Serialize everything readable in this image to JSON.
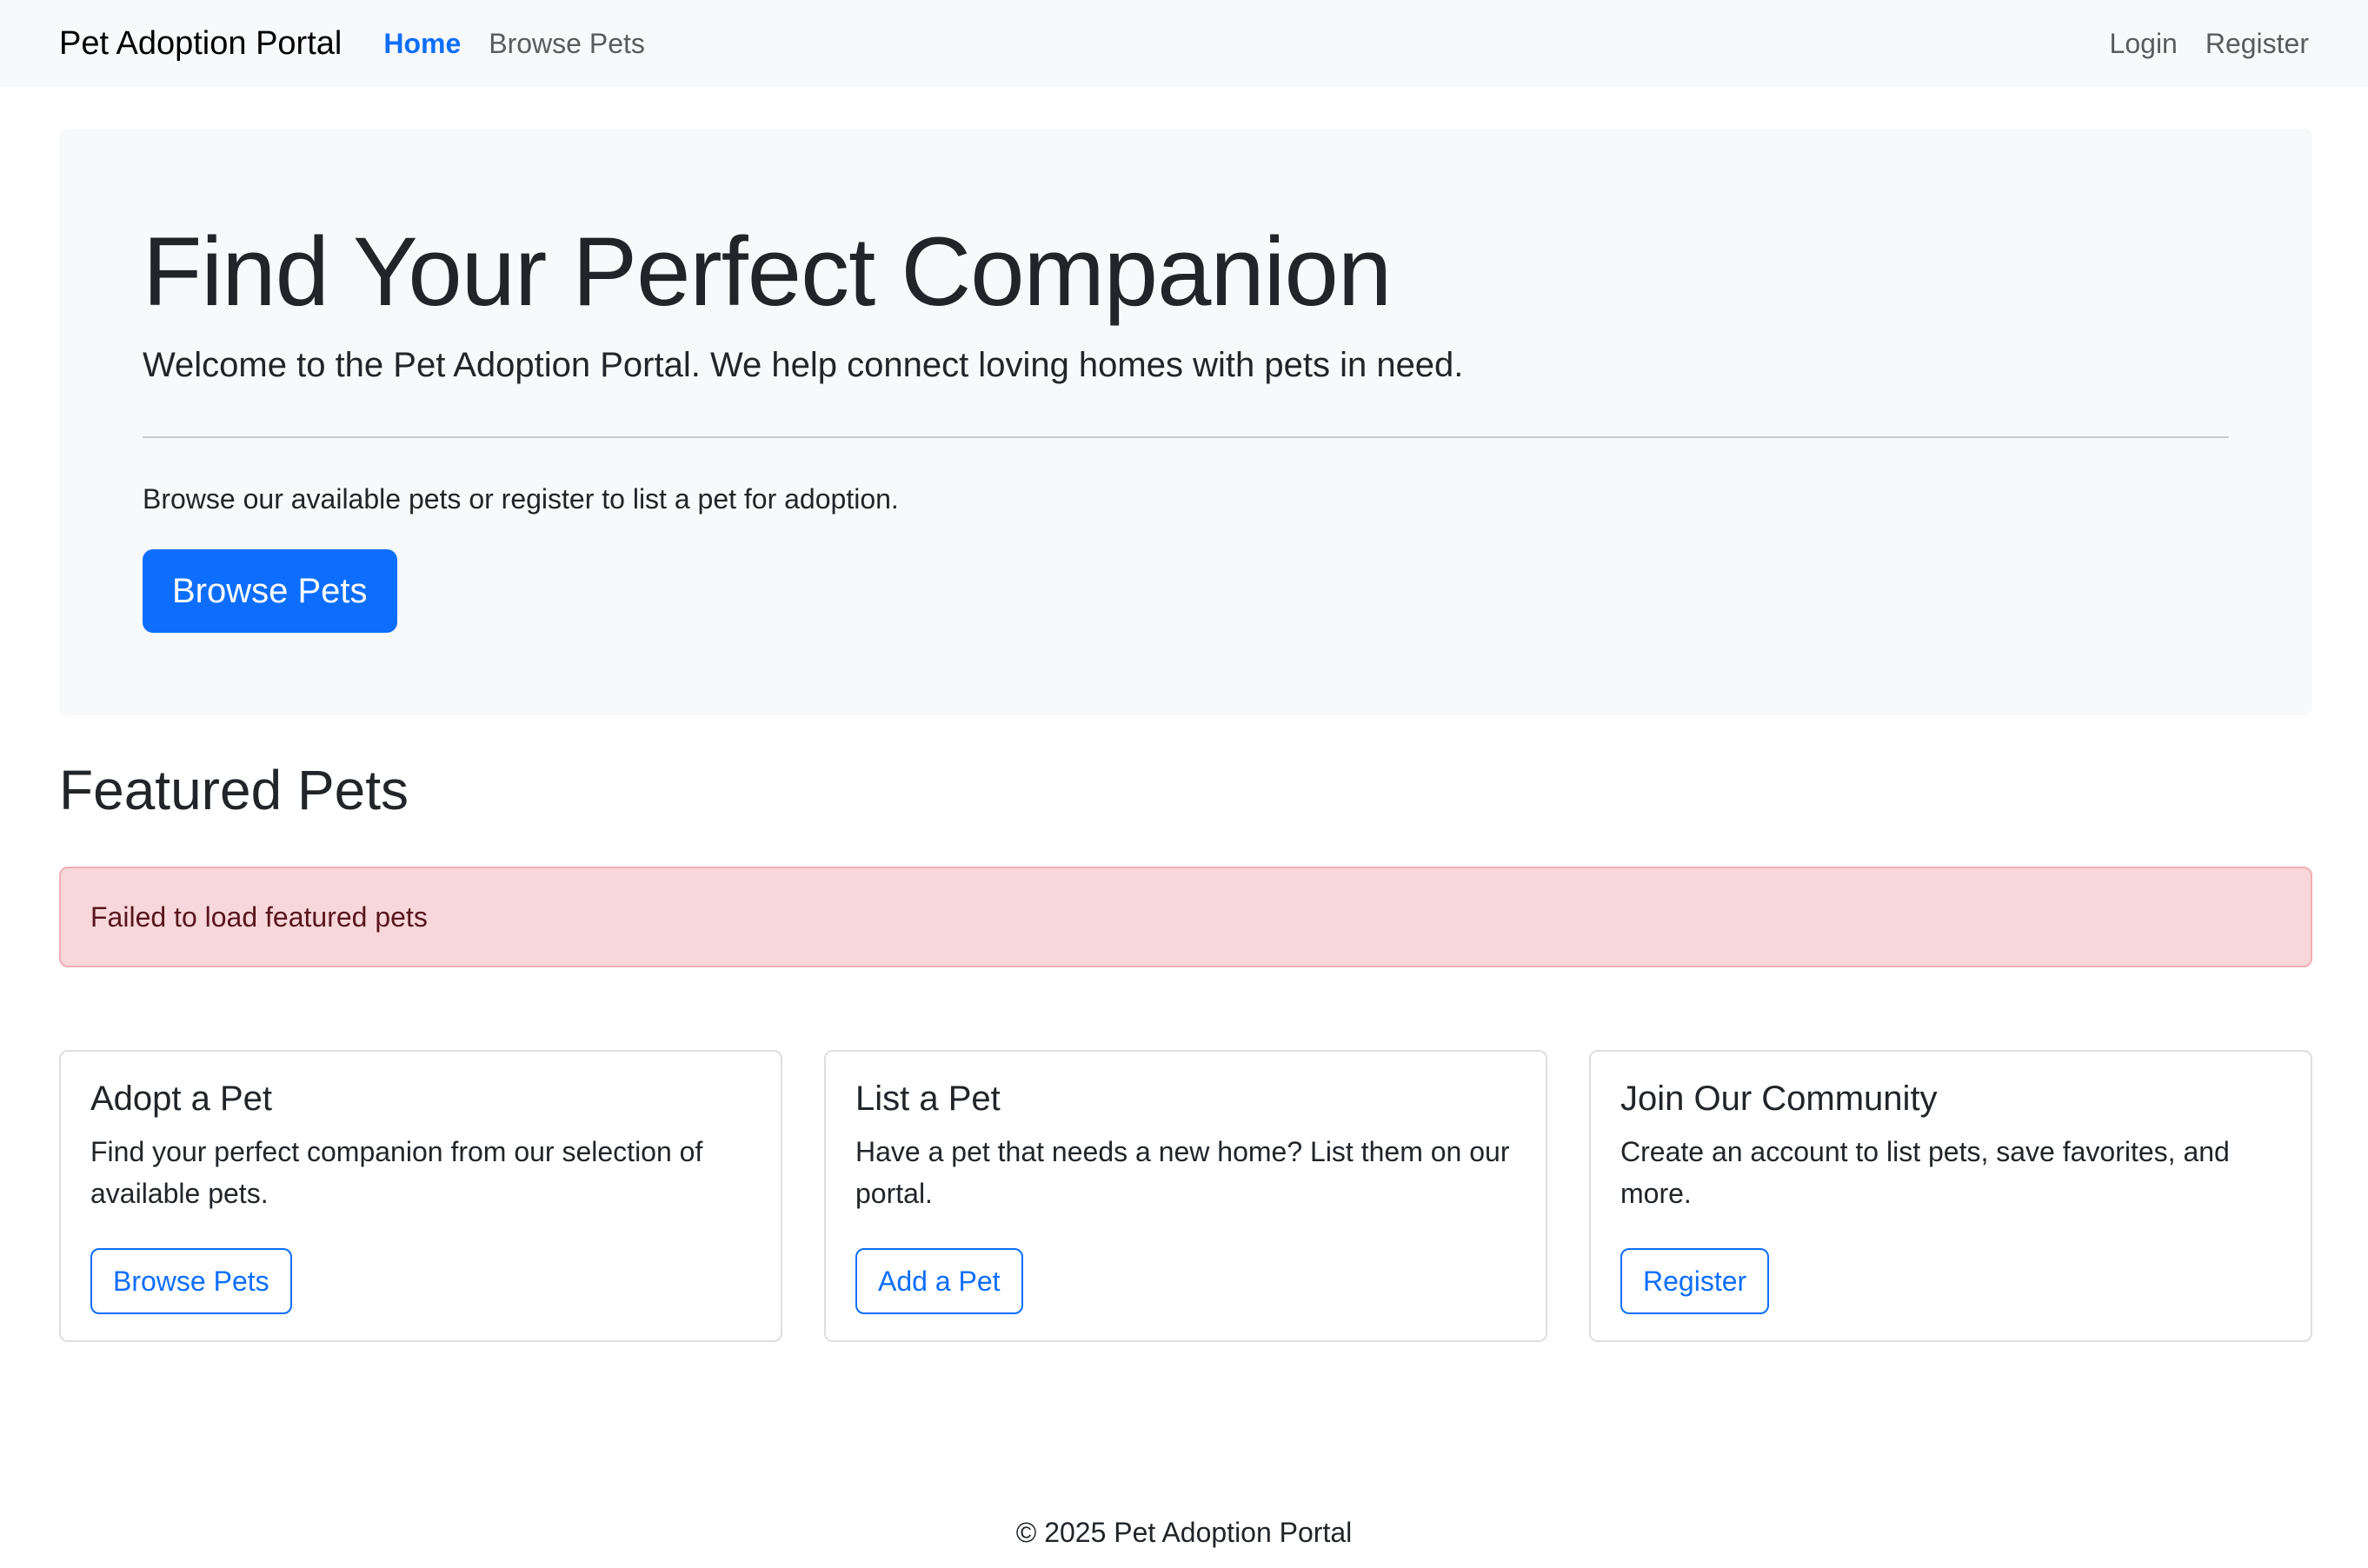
{
  "navbar": {
    "brand": "Pet Adoption Portal",
    "links": [
      {
        "label": "Home",
        "active": true
      },
      {
        "label": "Browse Pets",
        "active": false
      }
    ],
    "right_links": [
      {
        "label": "Login"
      },
      {
        "label": "Register"
      }
    ]
  },
  "hero": {
    "title": "Find Your Perfect Companion",
    "lead": "Welcome to the Pet Adoption Portal. We help connect loving homes with pets in need.",
    "text": "Browse our available pets or register to list a pet for adoption.",
    "button_label": "Browse Pets"
  },
  "featured": {
    "title": "Featured Pets",
    "error_message": "Failed to load featured pets"
  },
  "cards": [
    {
      "title": "Adopt a Pet",
      "text": "Find your perfect companion from our selection of available pets.",
      "button_label": "Browse Pets"
    },
    {
      "title": "List a Pet",
      "text": "Have a pet that needs a new home? List them on our portal.",
      "button_label": "Add a Pet"
    },
    {
      "title": "Join Our Community",
      "text": "Create an account to list pets, save favorites, and more.",
      "button_label": "Register"
    }
  ],
  "footer": {
    "text": "© 2025 Pet Adoption Portal"
  },
  "colors": {
    "primary": "#0d6efd",
    "navbar_bg": "#f8f9fa",
    "alert_bg": "#f8d7da",
    "alert_text": "#58151c"
  }
}
